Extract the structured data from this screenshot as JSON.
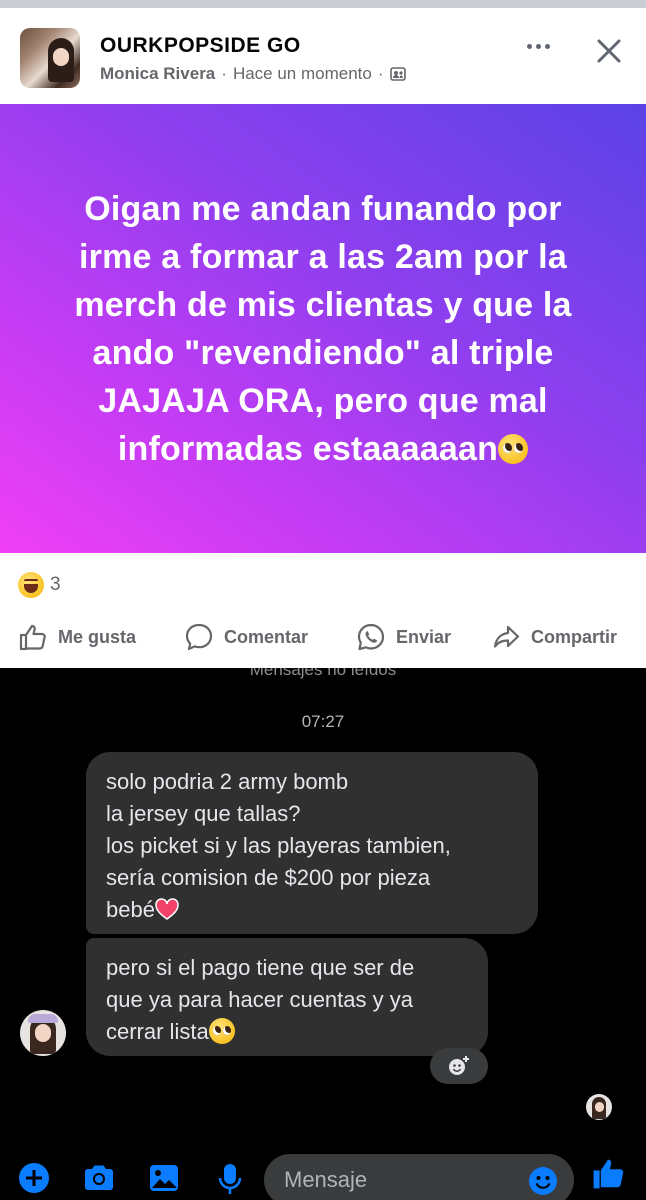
{
  "post": {
    "group_name": "OURKPOPSIDE GO",
    "author": "Monica Rivera",
    "separator": "·",
    "timestamp": "Hace un momento",
    "text_lines": [
      "Oigan me andan funando por",
      "irme a formar a las 2am por la",
      "merch de mis clientas y que la",
      "ando \"revendiendo\" al triple",
      "JAJAJA ORA, pero que mal",
      "informadas estaaaaaan"
    ],
    "reaction_count": "3",
    "actions": {
      "like": "Me gusta",
      "comment": "Comentar",
      "send": "Enviar",
      "share": "Compartir"
    },
    "colors": {
      "gradient_start": "#5b43e6",
      "gradient_end": "#f03ff5",
      "meta_gray": "#65676b"
    }
  },
  "messenger": {
    "unread_label": "Mensajes no leídos",
    "time": "07:27",
    "messages": [
      {
        "lines": [
          "solo podria 2 army bomb",
          "la jersey que tallas?",
          "los picket si y las playeras tambien,",
          "sería comision de $200 por pieza",
          "bebé"
        ]
      },
      {
        "lines": [
          "pero si el pago tiene que ser de",
          "que ya para hacer cuentas y ya",
          "cerrar lista"
        ]
      }
    ],
    "composer_placeholder": "Mensaje",
    "colors": {
      "accent": "#0a7cff",
      "bubble": "#303030"
    }
  }
}
